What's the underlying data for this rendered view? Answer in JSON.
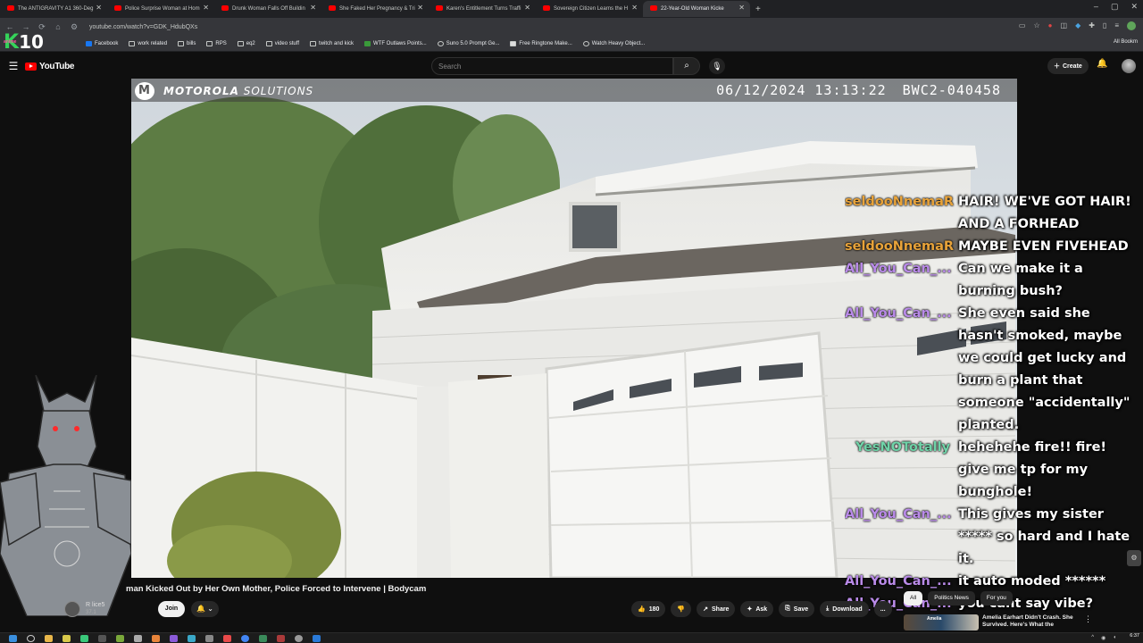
{
  "tabs": [
    {
      "title": "The ANTIGRAVITY A1 360-Deg",
      "active": false
    },
    {
      "title": "Police Surprise Woman at Hom",
      "active": false
    },
    {
      "title": "Drunk Woman Falls Off Buildin",
      "active": false
    },
    {
      "title": "She Faked Her Pregnancy & Tri",
      "active": false
    },
    {
      "title": "Karen's Entitlement Turns Traffi",
      "active": false
    },
    {
      "title": "Sovereign Citizen Learns the H",
      "active": false
    },
    {
      "title": "22-Year-Old Woman Kicke",
      "active": true
    }
  ],
  "browser": {
    "url": "youtube.com/watch?v=GDK_HdubQXs",
    "new_tab": "+",
    "all_bookmarks": "All Bookm"
  },
  "bookmarks": [
    {
      "label": "Facebook",
      "icon": "facebook-icon"
    },
    {
      "label": "work related",
      "icon": "folder-icon"
    },
    {
      "label": "bills",
      "icon": "folder-icon"
    },
    {
      "label": "RPS",
      "icon": "folder-icon"
    },
    {
      "label": "eq2",
      "icon": "folder-icon"
    },
    {
      "label": "video stuff",
      "icon": "folder-icon"
    },
    {
      "label": "twitch and kick",
      "icon": "folder-icon"
    },
    {
      "label": "WTF Outlaws Points...",
      "icon": "page-icon"
    },
    {
      "label": "Suno 5.0 Prompt Ge...",
      "icon": "page-icon"
    },
    {
      "label": "Free Ringtone Make...",
      "icon": "page-icon"
    },
    {
      "label": "Watch Heavy Object...",
      "icon": "page-icon"
    }
  ],
  "overlay": {
    "k": "K",
    "number": "10",
    "tag": "anime"
  },
  "youtube": {
    "logo": "YouTube",
    "search_placeholder": "Search",
    "create_label": "Create"
  },
  "bodycam": {
    "brand_bold": "MOTOROLA",
    "brand_light": " SOLUTIONS",
    "timestamp": "06/12/2024 13:13:22",
    "camera_id": "BWC2-040458"
  },
  "chat": [
    {
      "user": "seldooNnemaR",
      "color": "#e8a33a",
      "message": "HAIR! WE'VE GOT HAIR! AND A FORHEAD"
    },
    {
      "user": "seldooNnemaR",
      "color": "#e8a33a",
      "message": "MAYBE EVEN FIVEHEAD"
    },
    {
      "user": "All_You_Can_...",
      "color": "#b98ae8",
      "message": "Can we make it a burning bush?"
    },
    {
      "user": "All_You_Can_...",
      "color": "#b98ae8",
      "message": "She even said she hasn't smoked, maybe we could get lucky and burn a plant that someone \"accidentally\" planted."
    },
    {
      "user": "YesNOTotally",
      "color": "#6fd3a8",
      "message": "hehehehe fire!! fire! give me tp for my bunghole!"
    },
    {
      "user": "All_You_Can_...",
      "color": "#b98ae8",
      "message": "This gives my sister ***** so hard and I hate it."
    },
    {
      "user": "All_You_Can_...",
      "color": "#b98ae8",
      "message": "it auto moded ******"
    },
    {
      "user": "All_You_Can_...",
      "color": "#b98ae8",
      "message": "you cant say vibe?"
    }
  ],
  "video": {
    "title": "man Kicked Out by Her Own Mother, Police Forced to Intervene | Bodycam",
    "channel_partial": "R",
    "channel_suffix": "lice5",
    "subs_partial": "37.1",
    "join_label": "Join"
  },
  "actions": {
    "likes": "180",
    "share": "Share",
    "ask": "Ask",
    "save": "Save",
    "download": "Download",
    "more": "..."
  },
  "chips": [
    "All",
    "Politics News",
    "For you"
  ],
  "recommendation": {
    "thumb_text": "Amelia",
    "title": "Amelia Earhart Didn't Crash. She Survived. Here's What the"
  },
  "clock": {
    "time": "6:37"
  }
}
